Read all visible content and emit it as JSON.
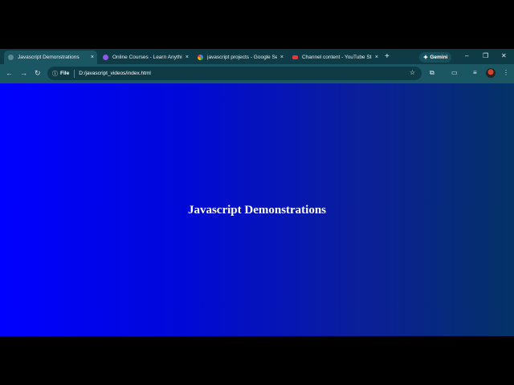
{
  "tabs": [
    {
      "title": "Javascript Demonstrations",
      "favicon_color": "#5a8a92",
      "active": true
    },
    {
      "title": "Online Courses - Learn Anythin",
      "favicon_color": "#8e5adf",
      "active": false
    },
    {
      "title": "javascript projects - Google Se",
      "favicon_color": "#ffffff",
      "active": false
    },
    {
      "title": "Channel content - YouTube Stu",
      "favicon_color": "#e53935",
      "active": false
    }
  ],
  "icons": {
    "close": "×",
    "new_tab": "+",
    "gemini_star": "✦",
    "minimize": "–",
    "restore": "❐",
    "window_close": "✕",
    "back": "←",
    "forward": "→",
    "reload": "↻",
    "info": "ⓘ",
    "bookmark": "☆",
    "extensions": "⧉",
    "cast": "▭",
    "media": "≡",
    "menu": "⋮"
  },
  "gemini_label": "Gemini",
  "address": {
    "scheme": "File",
    "url": "D:/javascript_videos/index.html"
  },
  "page": {
    "heading": "Javascript Demonstrations"
  },
  "colors": {
    "frame": "#0e3b45",
    "toolbar": "#1b5663",
    "gradient_start": "#0000ff",
    "gradient_end": "#043266"
  }
}
